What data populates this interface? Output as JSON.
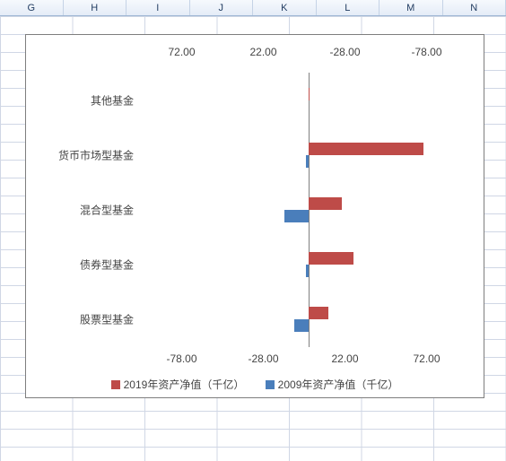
{
  "columns": [
    "G",
    "H",
    "I",
    "J",
    "K",
    "L",
    "M",
    "N"
  ],
  "chart_data": {
    "type": "bar",
    "orientation": "horizontal",
    "categories": [
      "其他基金",
      "货币市场型基金",
      "混合型基金",
      "债券型基金",
      "股票型基金"
    ],
    "series": [
      {
        "name": "2019年资产净值（千亿）",
        "color": "#be4b48",
        "values": [
          0.5,
          70,
          20,
          27,
          12
        ]
      },
      {
        "name": "2009年资产净值（千亿）",
        "color": "#4a7ebb",
        "values": [
          0,
          2,
          15,
          2,
          9
        ]
      }
    ],
    "x_ticks_bottom": [
      -78.0,
      -28.0,
      22.0,
      72.0
    ],
    "x_ticks_top": [
      72.0,
      22.0,
      -28.0,
      -78.0
    ],
    "xmin": -103,
    "xmax": 97,
    "legend_order": [
      "2019年资产净值（千亿）",
      "2009年资产净值（千亿）"
    ]
  }
}
